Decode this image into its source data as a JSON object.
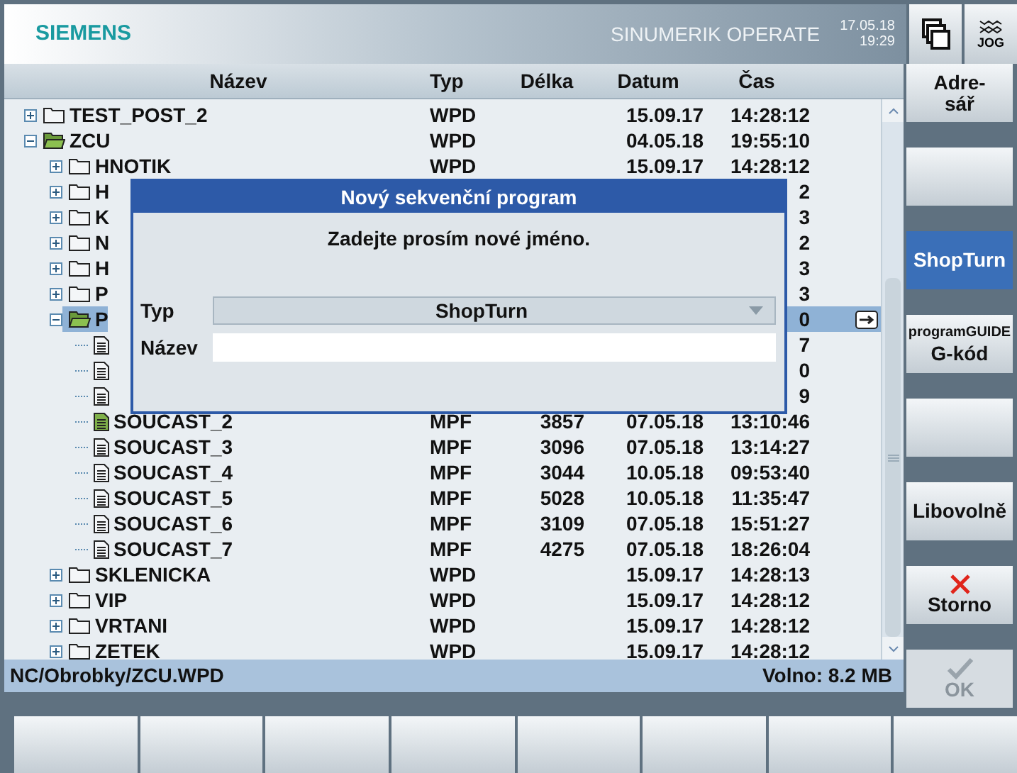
{
  "header": {
    "logo": "SIEMENS",
    "product": "SINUMERIK OPERATE",
    "date": "17.05.18",
    "time": "19:29",
    "jog_label": "JOG"
  },
  "file_list": {
    "columns": [
      "Název",
      "Typ",
      "Délka",
      "Datum",
      "Čas"
    ],
    "rows": [
      {
        "kind": "folder",
        "name": "TEST_POST_2",
        "type": "WPD",
        "date": "15.09.17",
        "time": "14:28:12",
        "expanded": false,
        "selected": false
      },
      {
        "kind": "folder",
        "name": "ZCU",
        "type": "WPD",
        "date": "04.05.18",
        "time": "19:55:10",
        "expanded": true,
        "selected": false,
        "children": [
          {
            "kind": "folder",
            "name": "HNOTIK",
            "type": "WPD",
            "date": "15.09.17",
            "time": "14:28:12",
            "expanded": false,
            "selected": false
          },
          {
            "kind": "folder",
            "name": "H",
            "time": "2",
            "expanded": false,
            "selected": false
          },
          {
            "kind": "folder",
            "name": "K",
            "time": "3",
            "expanded": false,
            "selected": false
          },
          {
            "kind": "folder",
            "name": "N",
            "time": "2",
            "expanded": false,
            "selected": false
          },
          {
            "kind": "folder",
            "name": "H",
            "time": "3",
            "expanded": false,
            "selected": false
          },
          {
            "kind": "folder",
            "name": "P",
            "time": "3",
            "expanded": false,
            "selected": false
          },
          {
            "kind": "folder",
            "name": "P",
            "time": "0",
            "expanded": true,
            "selected": true,
            "children": [
              {
                "kind": "file",
                "time": "7",
                "current": false,
                "selected": false
              },
              {
                "kind": "file",
                "time": "0",
                "current": false,
                "selected": false
              },
              {
                "kind": "file",
                "time": "9",
                "current": false,
                "selected": false
              },
              {
                "kind": "file",
                "name": "SOUCAST_2",
                "type": "MPF",
                "length": "3857",
                "date": "07.05.18",
                "time": "13:10:46",
                "current": true,
                "selected": false
              },
              {
                "kind": "file",
                "name": "SOUCAST_3",
                "type": "MPF",
                "length": "3096",
                "date": "07.05.18",
                "time": "13:14:27",
                "current": false,
                "selected": false
              },
              {
                "kind": "file",
                "name": "SOUCAST_4",
                "type": "MPF",
                "length": "3044",
                "date": "10.05.18",
                "time": "09:53:40",
                "current": false,
                "selected": false
              },
              {
                "kind": "file",
                "name": "SOUCAST_5",
                "type": "MPF",
                "length": "5028",
                "date": "10.05.18",
                "time": "11:35:47",
                "current": false,
                "selected": false
              },
              {
                "kind": "file",
                "name": "SOUCAST_6",
                "type": "MPF",
                "length": "3109",
                "date": "07.05.18",
                "time": "15:51:27",
                "current": false,
                "selected": false
              },
              {
                "kind": "file",
                "name": "SOUCAST_7",
                "type": "MPF",
                "length": "4275",
                "date": "07.05.18",
                "time": "18:26:04",
                "current": false,
                "selected": false
              }
            ]
          },
          {
            "kind": "folder",
            "name": "SKLENICKA",
            "type": "WPD",
            "date": "15.09.17",
            "time": "14:28:13",
            "expanded": false,
            "selected": false
          },
          {
            "kind": "folder",
            "name": "VIP",
            "type": "WPD",
            "date": "15.09.17",
            "time": "14:28:12",
            "expanded": false,
            "selected": false
          },
          {
            "kind": "folder",
            "name": "VRTANI",
            "type": "WPD",
            "date": "15.09.17",
            "time": "14:28:12",
            "expanded": false,
            "selected": false
          },
          {
            "kind": "folder",
            "name": "ZETEK",
            "type": "WPD",
            "date": "15.09.17",
            "time": "14:28:12",
            "expanded": false,
            "selected": false
          }
        ]
      }
    ]
  },
  "status_bar": {
    "path": "NC/Obrobky/ZCU.WPD",
    "free": "Volno: 8.2 MB"
  },
  "dialog": {
    "title": "Nový sekvenční program",
    "prompt": "Zadejte prosím nové jméno.",
    "fields": [
      {
        "kind": "dropdown",
        "label": "Typ",
        "value": "ShopTurn"
      },
      {
        "kind": "input",
        "label": "Název"
      }
    ]
  },
  "vertical_softkeys": [
    {
      "kind": "text",
      "lines": [
        "Adre-",
        "sář"
      ],
      "selected": false,
      "disabled": false
    },
    {
      "kind": "text",
      "selected": false,
      "disabled": false
    },
    {
      "kind": "text",
      "lines": [
        "ShopTurn"
      ],
      "selected": true,
      "disabled": false
    },
    {
      "kind": "text",
      "small": "programGUIDE",
      "lines": [
        "G-kód"
      ],
      "selected": false,
      "disabled": false
    },
    {
      "kind": "text",
      "selected": false,
      "disabled": false
    },
    {
      "kind": "text",
      "lines": [
        "Libovolně"
      ],
      "selected": false,
      "disabled": false
    },
    {
      "kind": "cancel",
      "lines": [
        "Storno"
      ],
      "selected": false,
      "disabled": false
    },
    {
      "kind": "ok",
      "lines": [
        "OK"
      ],
      "selected": false,
      "disabled": true
    }
  ],
  "horizontal_softkeys": [
    {
      "selected": false
    },
    {
      "selected": false
    },
    {
      "selected": false
    },
    {
      "selected": false
    },
    {
      "selected": false
    },
    {
      "selected": false
    },
    {
      "selected": false
    },
    {
      "selected": false
    }
  ]
}
